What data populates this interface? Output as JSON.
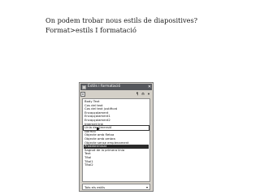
{
  "slide": {
    "line1": "On podem trobar nous estils de diapositives?",
    "line2": "Format>estils I formatació"
  },
  "panel": {
    "title": "Estils i formatació",
    "close_glyph": "✕",
    "toolbar": {
      "new_style_glyph": "¶",
      "list_glyph": "≡",
      "fill_glyph": "⟰",
      "menu_glyph": "▾"
    },
    "styles": [
      "Body Text",
      "Cos del text",
      "Cos del text justificat",
      "Encapçalament",
      "Encapçalament1",
      "Encapçalament2",
      "Internet link",
      "Línia de dimensió",
      "Normal",
      "Objecte amb fletxa",
      "Objecte amb ombra",
      "Objecte sense emplenament",
      "Predeterminat",
      "Sagnat de la primera línia",
      "Text",
      "Títol",
      "Títol1",
      "Títol2"
    ],
    "selected_index": 12,
    "boxed_index": 7,
    "filter": {
      "value": "Tots els estils",
      "chevron": "▾"
    }
  },
  "colors": {
    "titlebar": "#55575c",
    "panel_bg": "#d4d0c8",
    "selection": "#2a2a2a"
  }
}
